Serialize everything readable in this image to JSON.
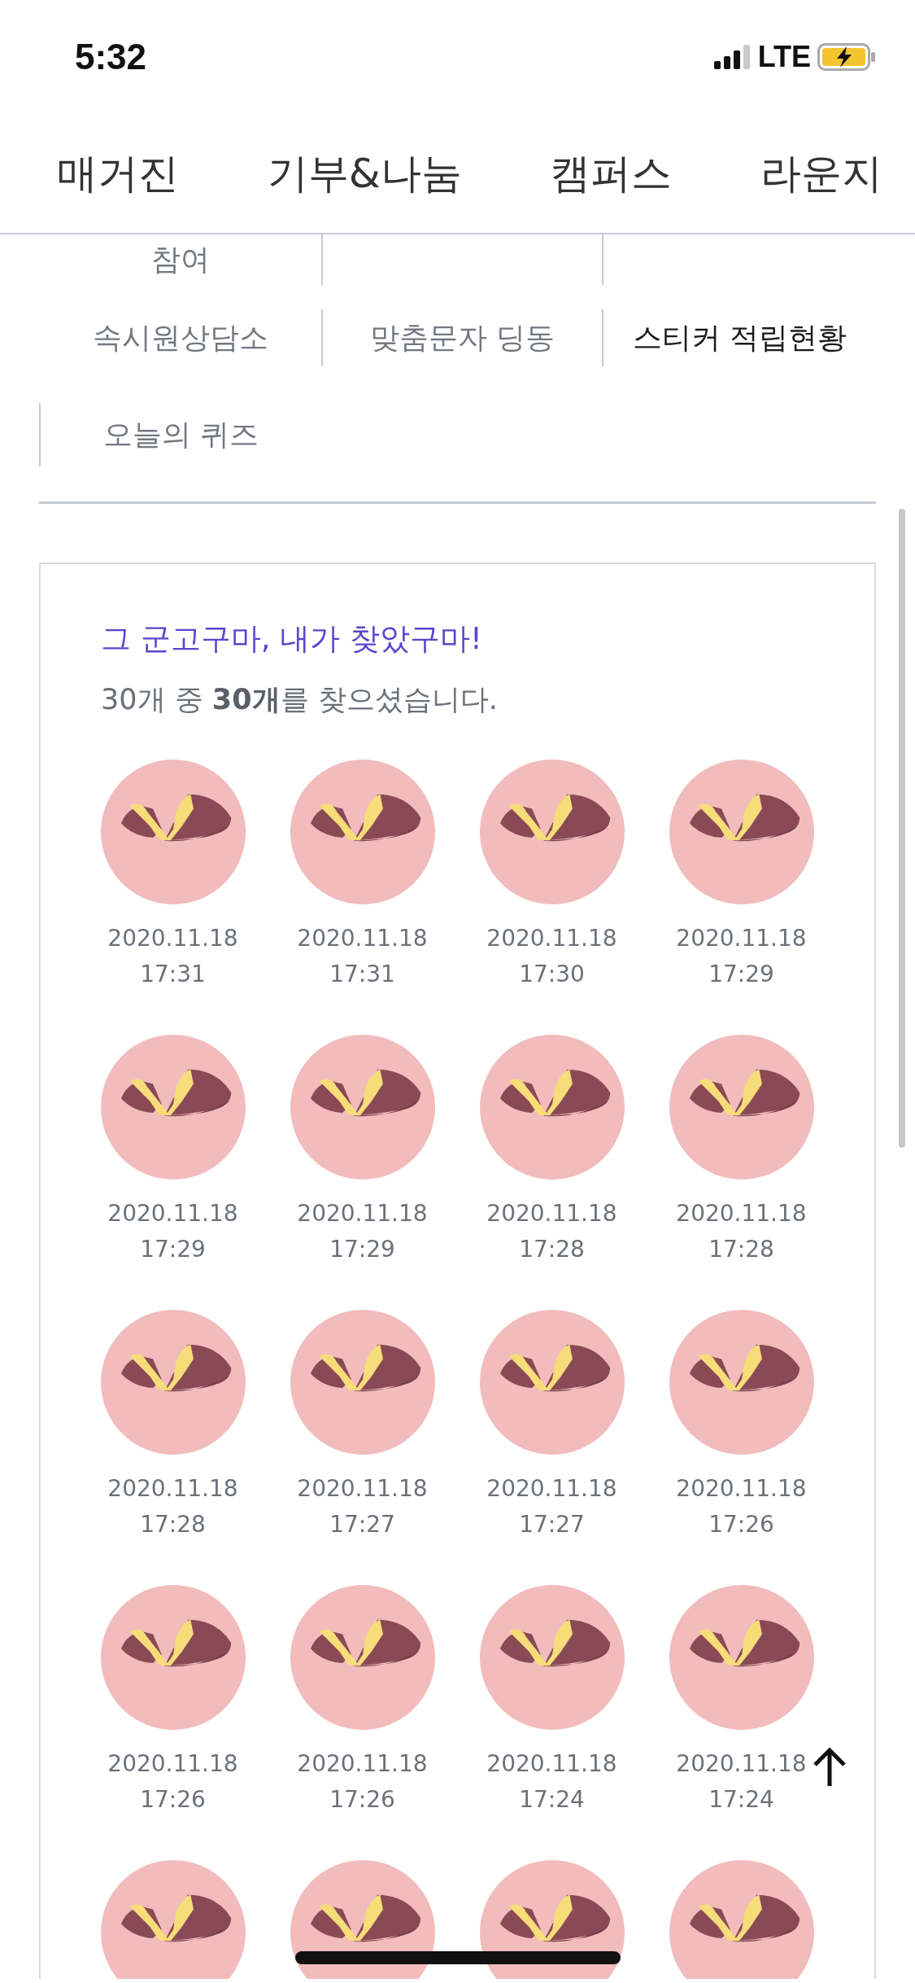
{
  "status_bar": {
    "time": "5:32",
    "network": "LTE"
  },
  "top_nav": [
    {
      "label": "매거진"
    },
    {
      "label": "기부&나눔"
    },
    {
      "label": "캠퍼스"
    },
    {
      "label": "라운지"
    }
  ],
  "sub_menu": [
    {
      "label": "참여",
      "selected": false,
      "divider": false
    },
    {
      "kind": "cut",
      "divider": true
    },
    {
      "kind": "cut",
      "divider": true
    },
    {
      "label": "속시원상담소",
      "selected": false,
      "divider": false
    },
    {
      "label": "맞춤문자 딩동",
      "selected": false,
      "divider": true
    },
    {
      "label": "스티커 적립현황",
      "selected": true,
      "divider": true
    },
    {
      "label": "오늘의 퀴즈",
      "selected": false,
      "divider": true
    }
  ],
  "sticker_card": {
    "title": "그 군고구마, 내가 찾았구마!",
    "summary": "30개 중 **30개**를 찾으셨습니다.",
    "stickers": [
      {
        "date": "2020.11.18",
        "time": "17:31"
      },
      {
        "date": "2020.11.18",
        "time": "17:31"
      },
      {
        "date": "2020.11.18",
        "time": "17:30"
      },
      {
        "date": "2020.11.18",
        "time": "17:29"
      },
      {
        "date": "2020.11.18",
        "time": "17:29"
      },
      {
        "date": "2020.11.18",
        "time": "17:29"
      },
      {
        "date": "2020.11.18",
        "time": "17:28"
      },
      {
        "date": "2020.11.18",
        "time": "17:28"
      },
      {
        "date": "2020.11.18",
        "time": "17:28"
      },
      {
        "date": "2020.11.18",
        "time": "17:27"
      },
      {
        "date": "2020.11.18",
        "time": "17:27"
      },
      {
        "date": "2020.11.18",
        "time": "17:26"
      },
      {
        "date": "2020.11.18",
        "time": "17:26"
      },
      {
        "date": "2020.11.18",
        "time": "17:26"
      },
      {
        "date": "2020.11.18",
        "time": "17:24"
      },
      {
        "date": "2020.11.18",
        "time": "17:24"
      },
      {
        "kind": "cut"
      },
      {
        "kind": "cut"
      },
      {
        "kind": "cut"
      },
      {
        "kind": "cut"
      }
    ]
  }
}
